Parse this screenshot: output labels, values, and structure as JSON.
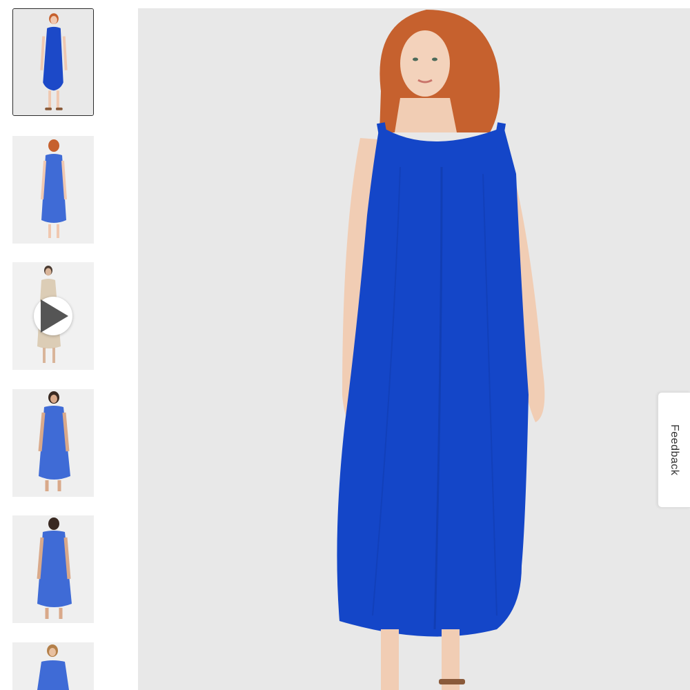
{
  "gallery": {
    "thumbnails": [
      {
        "view": "front",
        "dress_color": "#1c49c8",
        "selected": true
      },
      {
        "view": "back",
        "dress_color": "#3f6bd6",
        "selected": false
      },
      {
        "view": "video",
        "dress_color": "#dccdb6",
        "selected": false,
        "has_play_icon": true
      },
      {
        "view": "front-curvy",
        "dress_color": "#3f6bd6",
        "selected": false
      },
      {
        "view": "back-curvy",
        "dress_color": "#3f6bd6",
        "selected": false
      },
      {
        "view": "front-partial",
        "dress_color": "#3f6bd6",
        "selected": false
      }
    ],
    "play_icon": "play-icon"
  },
  "main_image": {
    "subject": "model-in-blue-midi-dress",
    "dress_color": "#1446c8",
    "hair_color": "#c6612e",
    "background": "#e8e8e8"
  },
  "feedback": {
    "label": "Feedback"
  }
}
